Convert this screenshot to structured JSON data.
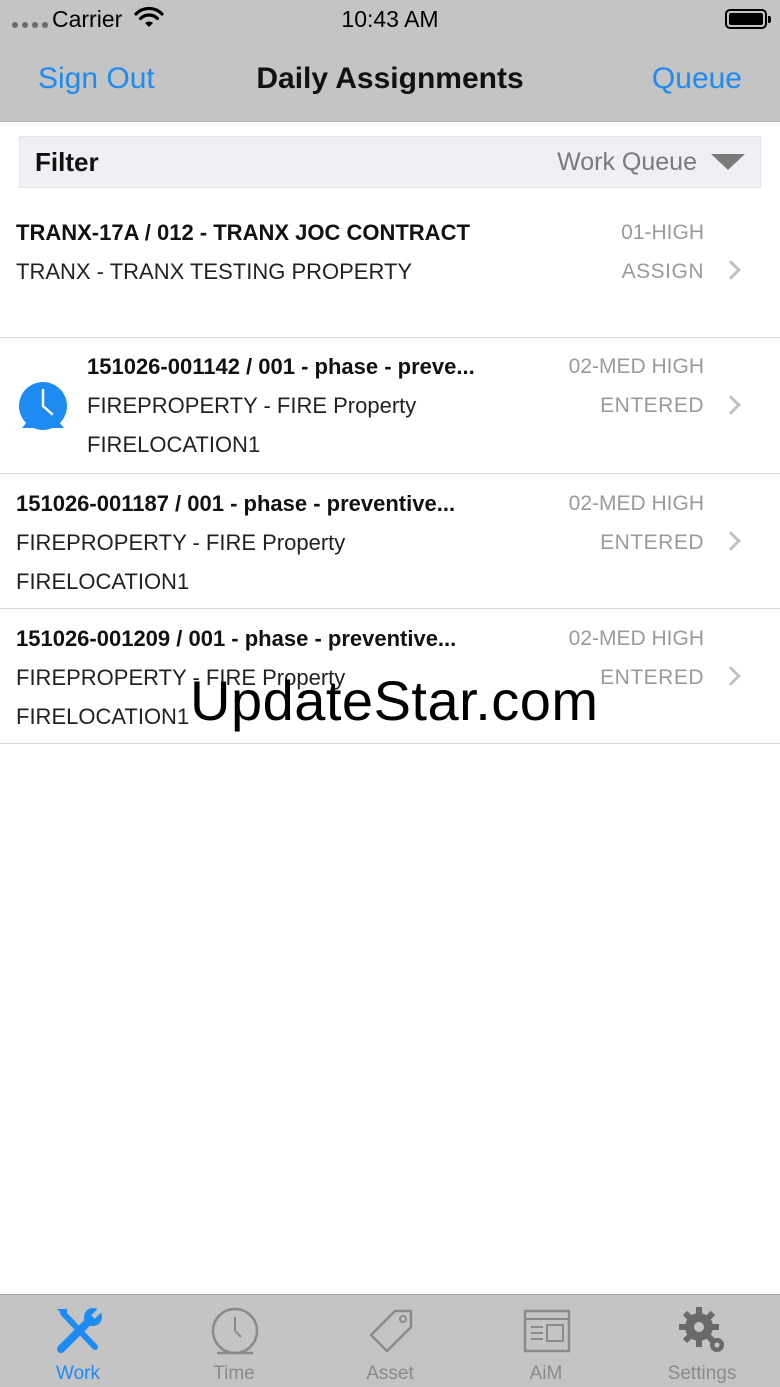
{
  "status_bar": {
    "carrier": "Carrier",
    "time": "10:43 AM"
  },
  "nav": {
    "left_button": "Sign Out",
    "title": "Daily Assignments",
    "right_button": "Queue"
  },
  "filter": {
    "label": "Filter",
    "value": "Work Queue"
  },
  "assignments": [
    {
      "title": "TRANX-17A / 012 - TRANX JOC CONTRACT",
      "line2": "TRANX - TRANX TESTING PROPERTY",
      "line3": "",
      "priority": "01-HIGH",
      "status": "ASSIGN",
      "icon": ""
    },
    {
      "title": "151026-001142 / 001 - phase - preve...",
      "line2": "FIREPROPERTY - FIRE Property",
      "line3": "FIRELOCATION1",
      "priority": "02-MED HIGH",
      "status": "ENTERED",
      "icon": "alarm-clock-icon"
    },
    {
      "title": "151026-001187 / 001 - phase - preventive...",
      "line2": "FIREPROPERTY - FIRE Property",
      "line3": "FIRELOCATION1",
      "priority": "02-MED HIGH",
      "status": "ENTERED",
      "icon": ""
    },
    {
      "title": "151026-001209 / 001 - phase - preventive...",
      "line2": "FIREPROPERTY - FIRE Property",
      "line3": "FIRELOCATION1",
      "priority": "02-MED HIGH",
      "status": "ENTERED",
      "icon": ""
    }
  ],
  "watermark": "UpdateStar.com",
  "tabs": [
    {
      "label": "Work",
      "icon": "wrench-screwdriver-icon",
      "active": true
    },
    {
      "label": "Time",
      "icon": "clock-icon",
      "active": false
    },
    {
      "label": "Asset",
      "icon": "tag-icon",
      "active": false
    },
    {
      "label": "AiM",
      "icon": "window-icon",
      "active": false
    },
    {
      "label": "Settings",
      "icon": "gears-icon",
      "active": false
    }
  ],
  "colors": {
    "accent": "#1e8bf2",
    "bar_background": "#c4c4c4",
    "secondary_text": "#9a9a9a"
  }
}
